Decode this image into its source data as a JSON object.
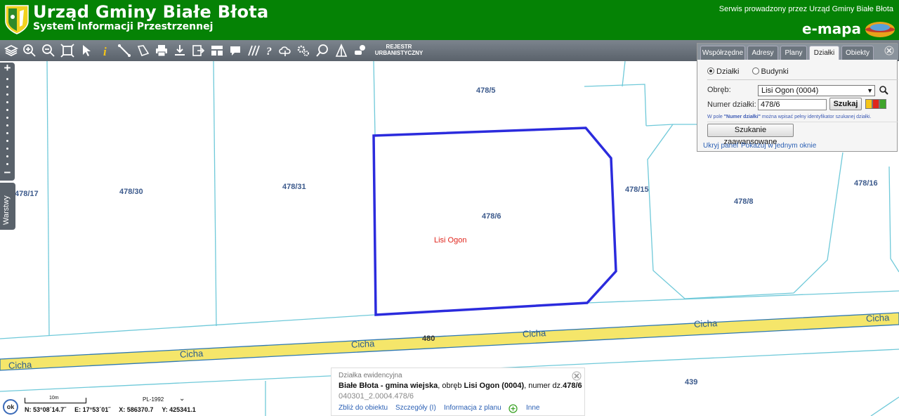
{
  "header": {
    "title": "Urząd Gminy Białe Błota",
    "subtitle": "System Informacji Przestrzennej",
    "service_text": "Serwis prowadzony przez Urząd Gminy Białe Błota",
    "brand": "e-mapa",
    "colors": {
      "header_bg": "#058205",
      "toolbar_bg": "#5a626b"
    }
  },
  "toolbar": {
    "tools": [
      "layers-icon",
      "zoom-in-icon",
      "zoom-out-icon",
      "zoom-extent-icon",
      "pointer-icon",
      "info-icon",
      "measure-line-icon",
      "measure-area-icon",
      "print-icon",
      "download-icon",
      "export-icon",
      "legend-icon",
      "comment-icon",
      "hatch-icon",
      "help-icon",
      "cloud-icon",
      "settings-icon",
      "search-map-icon",
      "flag-icon",
      "chat-icon"
    ],
    "rejestr_line1": "REJESTR",
    "rejestr_line2": "URBANISTYCZNY"
  },
  "map": {
    "parcels": [
      "478/5",
      "478/17",
      "478/30",
      "478/31",
      "478/6",
      "478/15",
      "478/8",
      "478/16",
      "439"
    ],
    "district": "Lisi Ogon",
    "street_name": "Cicha",
    "road_number": "480",
    "selected_parcel": "478/6",
    "colors": {
      "parcel_line": "#6fc9d9",
      "selection": "#2b2bdd",
      "road": "#f5e66a"
    }
  },
  "sidebar": {
    "layers_tab": "Warstwy"
  },
  "search_panel": {
    "tabs": [
      "Współrzędne",
      "Adresy",
      "Plany",
      "Działki",
      "Obiekty"
    ],
    "active_tab": "Działki",
    "radio_parcels": "Działki",
    "radio_buildings": "Budynki",
    "obreb_label": "Obręb:",
    "obreb_value": "Lisi Ogon (0004)",
    "number_label": "Numer działki:",
    "number_value": "478/6",
    "search_button": "Szukaj",
    "hint_prefix": "W pole ",
    "hint_bold": "\"Numer działki\"",
    "hint_suffix": " można wpisać pełny identyfikator szukanej działki.",
    "advanced_button": "Szukanie zaawansowane",
    "hide_panel": "Ukryj panel",
    "show_one_window": "Pokazuj w jednym oknie"
  },
  "info_popup": {
    "title": "Działka ewidencyjna",
    "municipality": "Białe Błota - gmina wiejska",
    "obreb_text": ", obręb ",
    "obreb_name": "Lisi Ogon (0004)",
    "number_text": ", numer dz.",
    "number": "478/6",
    "code": "040301_2.0004.478/6",
    "links": [
      "Zbliż do obiektu",
      "Szczegóły (I)",
      "Informacja z planu",
      "Inne"
    ]
  },
  "status": {
    "ok": "ok",
    "scale_label": "10m",
    "crs": "PL-1992",
    "lat": "N: 53°08´14.7˝",
    "lon": "E: 17°53´01˝",
    "x": "X: 586370.7",
    "y": "Y: 425341.1"
  }
}
